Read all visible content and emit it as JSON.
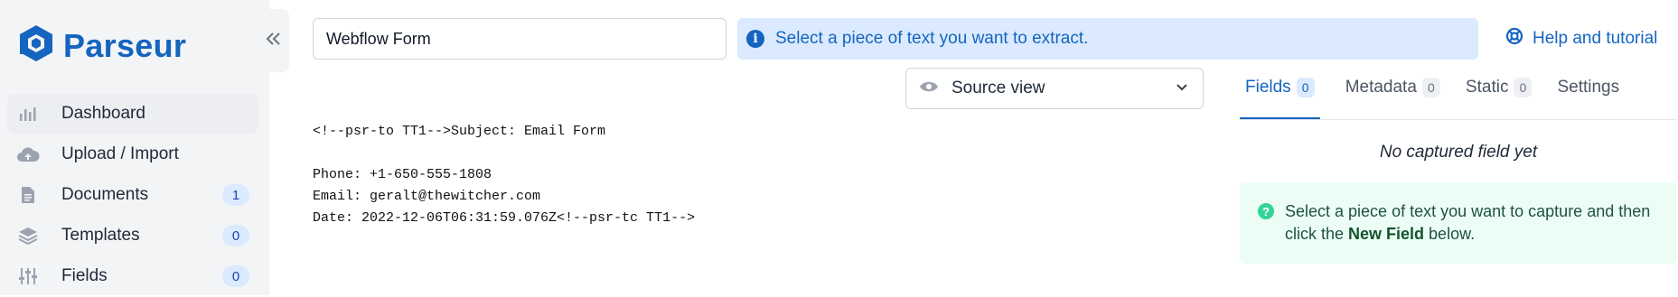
{
  "brand": {
    "name": "Parseur",
    "color": "#1565c0"
  },
  "sidebar": {
    "items": [
      {
        "label": "Dashboard",
        "icon": "chart-icon",
        "badge": null,
        "active": true
      },
      {
        "label": "Upload / Import",
        "icon": "cloud-upload-icon",
        "badge": null
      },
      {
        "label": "Documents",
        "icon": "document-icon",
        "badge": "1"
      },
      {
        "label": "Templates",
        "icon": "layers-icon",
        "badge": "0"
      },
      {
        "label": "Fields",
        "icon": "sliders-icon",
        "badge": "0"
      }
    ]
  },
  "toolbar": {
    "mailbox_name_value": "Webflow Form",
    "info_message": "Select a piece of text you want to extract.",
    "help_label": "Help and tutorial"
  },
  "viewer": {
    "mode_label": "Source view",
    "lines": [
      "<!--psr-to TT1-->Subject: Email Form",
      "",
      "Phone: +1-650-555-1808",
      "Email: geralt@thewitcher.com",
      "Date: 2022-12-06T06:31:59.076Z<!--psr-tc TT1-->"
    ]
  },
  "panel": {
    "tabs": [
      {
        "label": "Fields",
        "count": "0",
        "active": true
      },
      {
        "label": "Metadata",
        "count": "0"
      },
      {
        "label": "Static",
        "count": "0"
      },
      {
        "label": "Settings",
        "count": null
      }
    ],
    "empty_message": "No captured field yet",
    "help": {
      "before": "Select a piece of text you want to capture and then click the ",
      "strong": "New Field",
      "after": " below."
    }
  }
}
